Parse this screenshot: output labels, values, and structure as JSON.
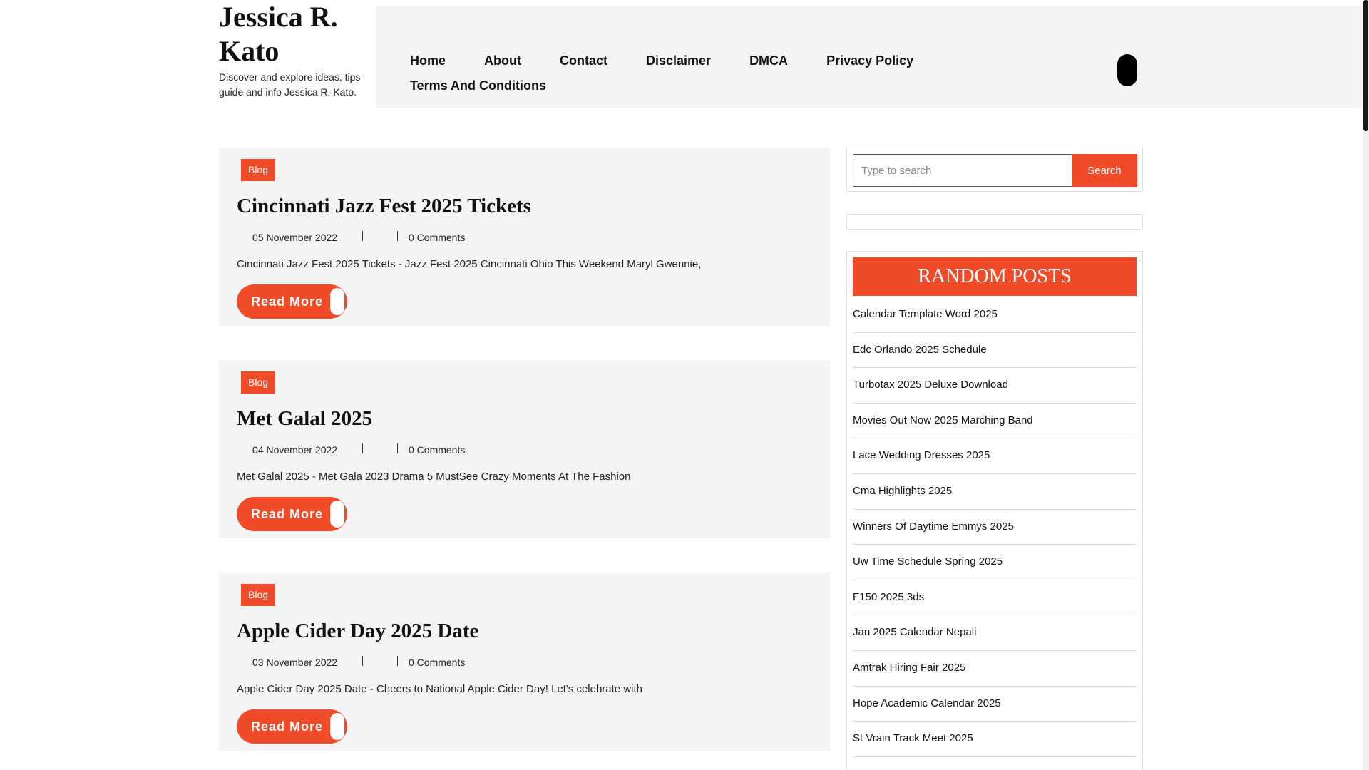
{
  "header": {
    "site_title": "Jessica R. Kato",
    "tagline": "Discover and explore ideas, tips guide and info Jessica R. Kato."
  },
  "nav": {
    "items": [
      {
        "label": "Home"
      },
      {
        "label": "About"
      },
      {
        "label": "Contact"
      },
      {
        "label": "Disclaimer"
      },
      {
        "label": "DMCA"
      },
      {
        "label": "Privacy Policy"
      },
      {
        "label": "Terms And Conditions"
      }
    ]
  },
  "posts": [
    {
      "category": "Blog",
      "title": "Cincinnati Jazz Fest 2025 Tickets",
      "date": "05 November 2022",
      "comments": "0 Comments",
      "excerpt": "Cincinnati Jazz Fest 2025 Tickets - Jazz Fest 2025 Cincinnati Ohio This Weekend Maryl Gwennie,",
      "read_more": "Read More"
    },
    {
      "category": "Blog",
      "title": "Met Galal 2025",
      "date": "04 November 2022",
      "comments": "0 Comments",
      "excerpt": "Met Galal 2025 - Met Gala 2023 Drama 5 MustSee Crazy Moments At The Fashion",
      "read_more": "Read More"
    },
    {
      "category": "Blog",
      "title": "Apple Cider Day 2025 Date",
      "date": "03 November 2022",
      "comments": "0 Comments",
      "excerpt": "Apple Cider Day 2025 Date - Cheers to National Apple Cider Day! Let's celebrate with",
      "read_more": "Read More"
    }
  ],
  "search": {
    "placeholder": "Type to search",
    "button_label": "Search"
  },
  "random_posts": {
    "title": "RANDOM POSTS",
    "items": [
      "Calendar Template Word 2025",
      "Edc Orlando 2025 Schedule",
      "Turbotax 2025 Deluxe Download",
      "Movies Out Now 2025 Marching Band",
      "Lace Wedding Dresses 2025",
      "Cma Highlights 2025",
      "Winners Of Daytime Emmys 2025",
      "Uw Time Schedule Spring 2025",
      "F150 2025 3ds",
      "Jan 2025 Calendar Nepali",
      "Amtrak Hiring Fair 2025",
      "Hope Academic Calendar 2025",
      "St Vrain Track Meet 2025"
    ]
  },
  "colors": {
    "accent": "#f24b2a",
    "card_background": "#f5f4f4"
  }
}
